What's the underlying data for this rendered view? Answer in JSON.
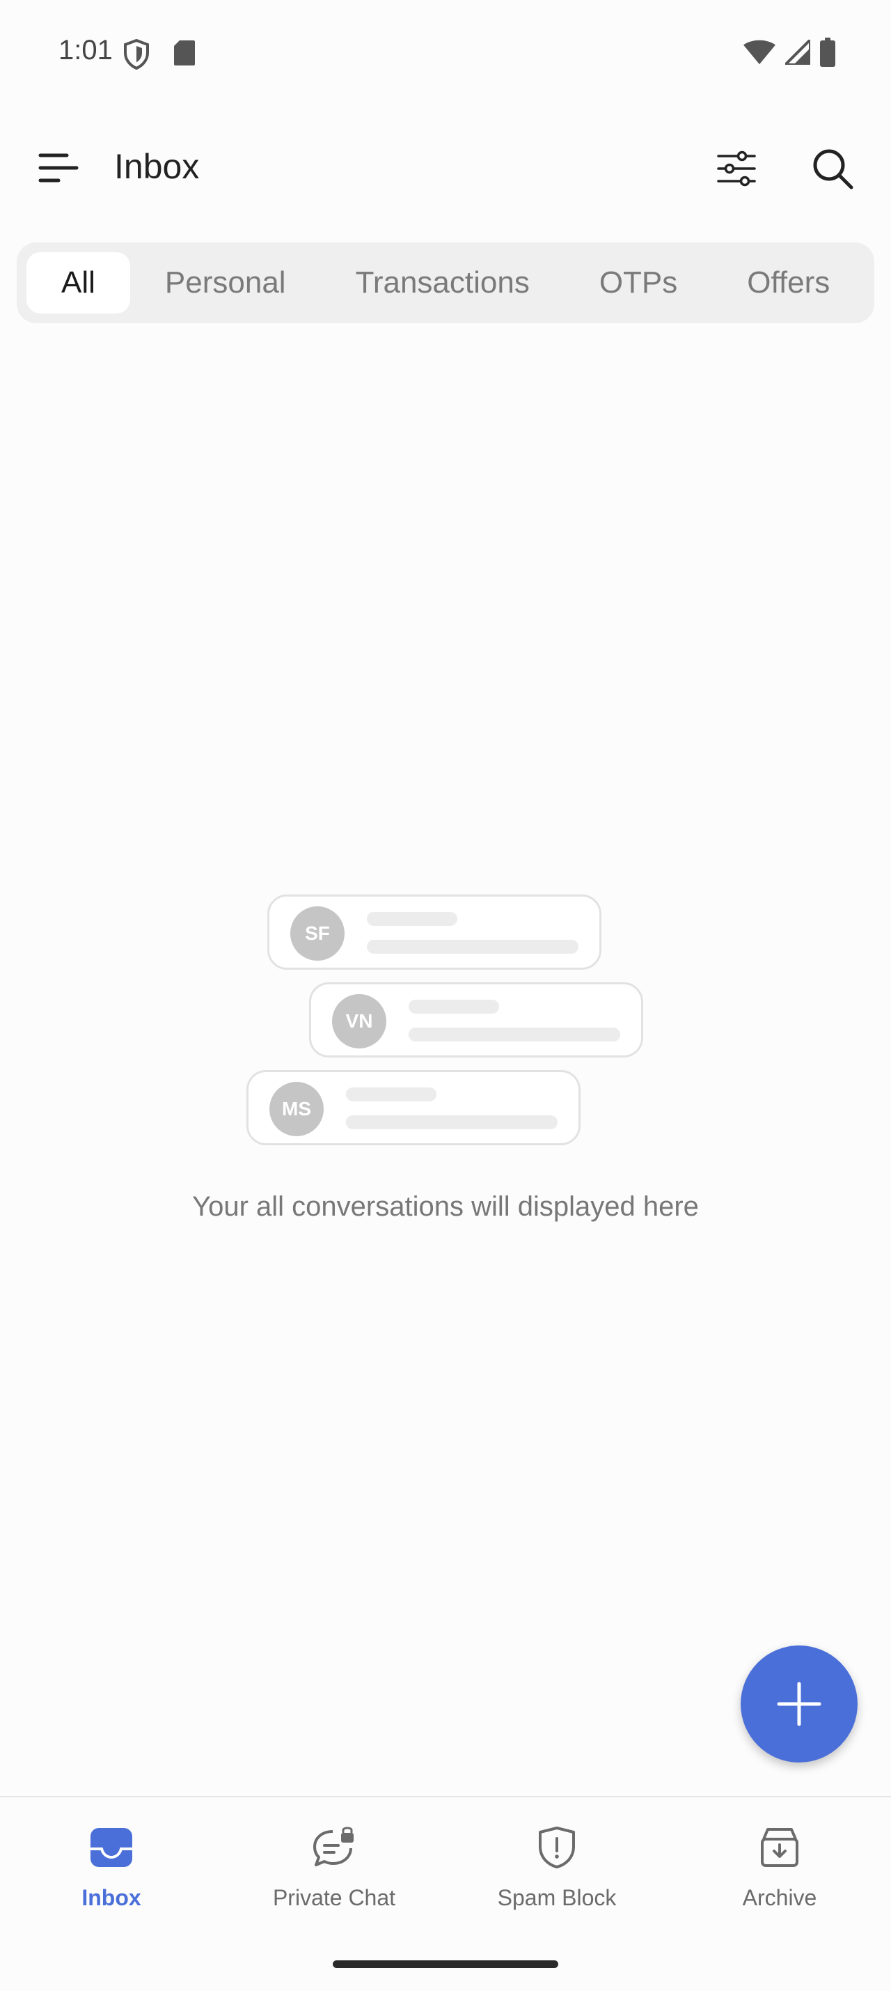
{
  "status_bar": {
    "time": "1:01"
  },
  "app_bar": {
    "title": "Inbox"
  },
  "tabs": [
    {
      "label": "All",
      "active": true
    },
    {
      "label": "Personal",
      "active": false
    },
    {
      "label": "Transactions",
      "active": false
    },
    {
      "label": "OTPs",
      "active": false
    },
    {
      "label": "Offers",
      "active": false
    }
  ],
  "empty_state": {
    "avatars": [
      "SF",
      "VN",
      "MS"
    ],
    "message": "Your all conversations will displayed here"
  },
  "bottom_nav": [
    {
      "label": "Inbox",
      "icon": "inbox-icon",
      "active": true
    },
    {
      "label": "Private Chat",
      "icon": "private-chat-icon",
      "active": false
    },
    {
      "label": "Spam Block",
      "icon": "spam-block-icon",
      "active": false
    },
    {
      "label": "Archive",
      "icon": "archive-icon",
      "active": false
    }
  ],
  "colors": {
    "accent": "#4a6fd8",
    "tab_bg": "#efefef",
    "avatar": "#c5c5c5"
  }
}
